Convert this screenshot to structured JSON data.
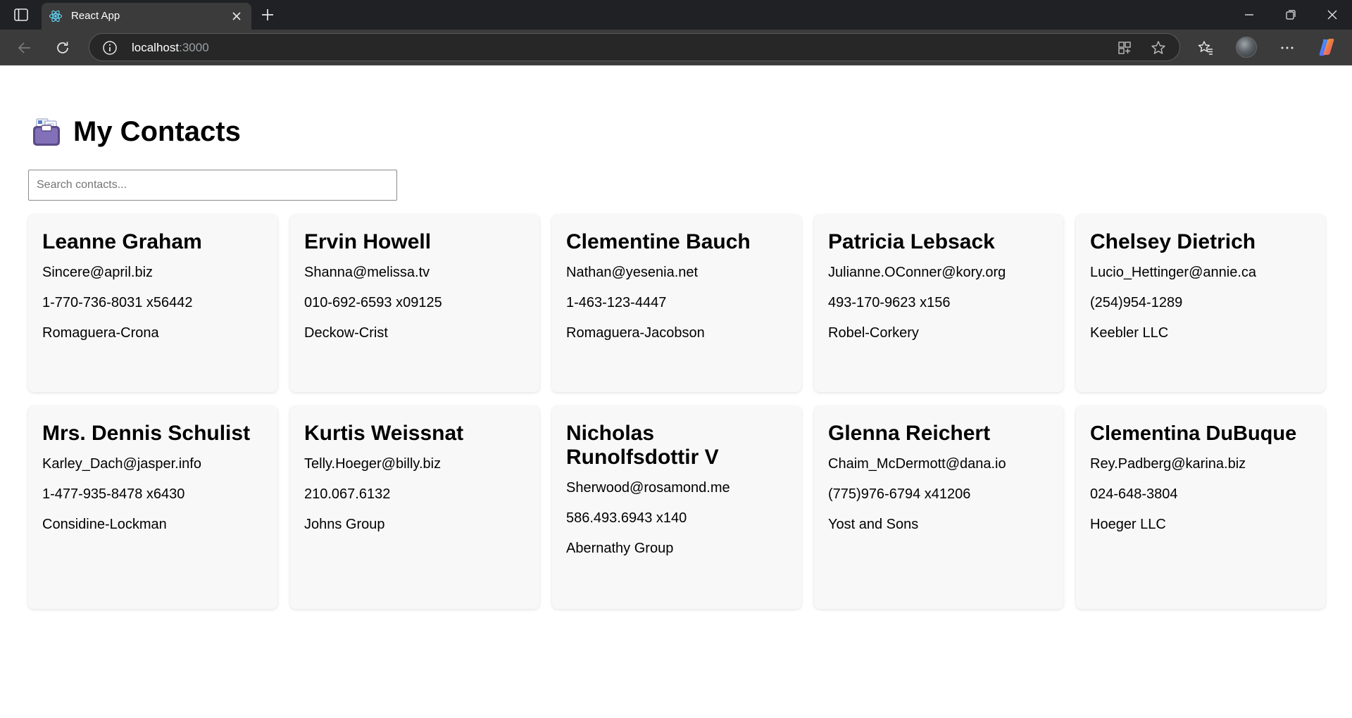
{
  "browser": {
    "tab_title": "React App",
    "address_host": "localhost",
    "address_port": ":3000"
  },
  "header": {
    "title": "My Contacts",
    "icon": "card-index-emoji-icon"
  },
  "search": {
    "placeholder": "Search contacts...",
    "value": ""
  },
  "contacts": [
    {
      "name": "Leanne Graham",
      "email": "Sincere@april.biz",
      "phone": "1-770-736-8031 x56442",
      "company": "Romaguera-Crona"
    },
    {
      "name": "Ervin Howell",
      "email": "Shanna@melissa.tv",
      "phone": "010-692-6593 x09125",
      "company": "Deckow-Crist"
    },
    {
      "name": "Clementine Bauch",
      "email": "Nathan@yesenia.net",
      "phone": "1-463-123-4447",
      "company": "Romaguera-Jacobson"
    },
    {
      "name": "Patricia Lebsack",
      "email": "Julianne.OConner@kory.org",
      "phone": "493-170-9623 x156",
      "company": "Robel-Corkery"
    },
    {
      "name": "Chelsey Dietrich",
      "email": "Lucio_Hettinger@annie.ca",
      "phone": "(254)954-1289",
      "company": "Keebler LLC"
    },
    {
      "name": "Mrs. Dennis Schulist",
      "email": "Karley_Dach@jasper.info",
      "phone": "1-477-935-8478 x6430",
      "company": "Considine-Lockman"
    },
    {
      "name": "Kurtis Weissnat",
      "email": "Telly.Hoeger@billy.biz",
      "phone": "210.067.6132",
      "company": "Johns Group"
    },
    {
      "name": "Nicholas Runolfsdottir V",
      "email": "Sherwood@rosamond.me",
      "phone": "586.493.6943 x140",
      "company": "Abernathy Group"
    },
    {
      "name": "Glenna Reichert",
      "email": "Chaim_McDermott@dana.io",
      "phone": "(775)976-6794 x41206",
      "company": "Yost and Sons"
    },
    {
      "name": "Clementina DuBuque",
      "email": "Rey.Padberg@karina.biz",
      "phone": "024-648-3804",
      "company": "Hoeger LLC"
    }
  ]
}
